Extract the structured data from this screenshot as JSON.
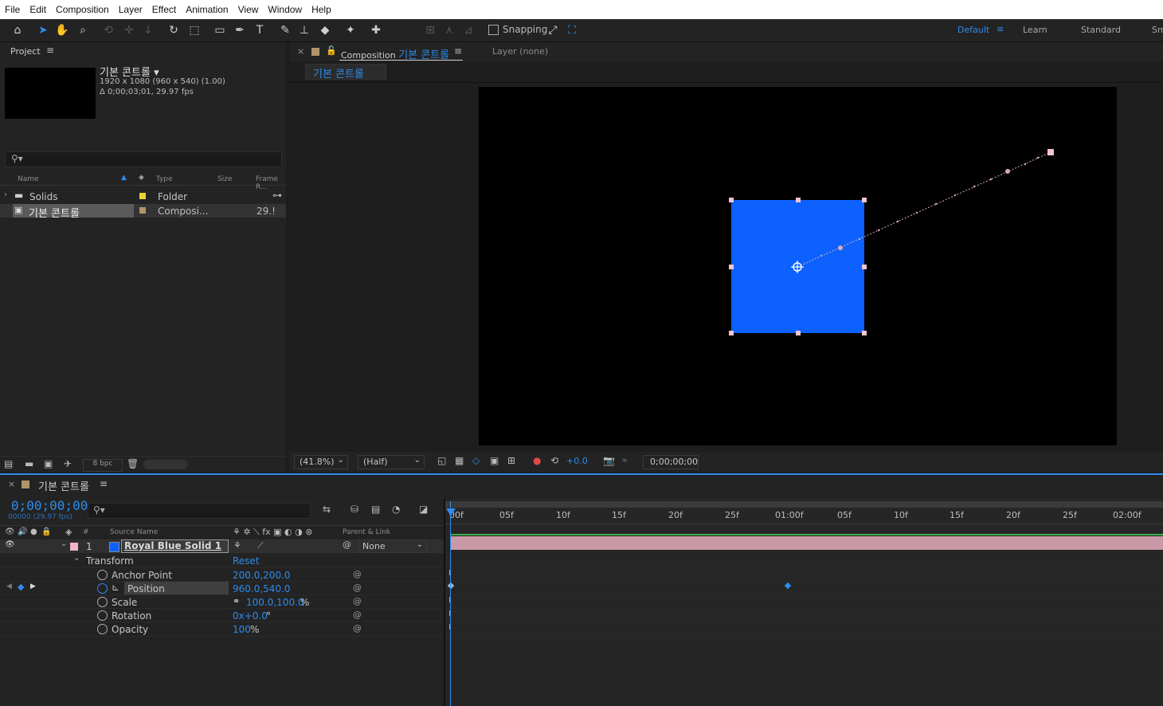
{
  "menu": [
    "File",
    "Edit",
    "Composition",
    "Layer",
    "Effect",
    "Animation",
    "View",
    "Window",
    "Help"
  ],
  "toolbar": {
    "snapping_label": "Snapping",
    "workspaces": [
      "Default",
      "Learn",
      "Standard",
      "Sm"
    ],
    "active_workspace": "Default"
  },
  "project": {
    "tab_label": "Project",
    "comp_name": "기본 콘트롤",
    "comp_info_1": "1920 x 1080  (960 x 540) (1.00)",
    "comp_info_2": "Δ 0;00;03;01, 29.97 fps",
    "search_placeholder": "",
    "columns": [
      "Name",
      "Type",
      "Size",
      "Frame R..."
    ],
    "items": [
      {
        "name": "Solids",
        "type": "Folder",
        "size": "",
        "rate": "",
        "label_color": "#e8d337"
      },
      {
        "name": "기본 콘트롤",
        "type": "Composi...",
        "size": "",
        "rate": "29.!",
        "label_color": "#b0946a"
      }
    ],
    "bpc": "8 bpc"
  },
  "composition": {
    "tab_prefix": "Composition",
    "tab_name": "기본 콘트롤",
    "layer_tab": "Layer  (none)",
    "flow_tab": "기본 콘트롤",
    "zoom": "(41.8%)",
    "resolution": "(Half)",
    "exposure": "+0.0",
    "timecode": "0;00;00;00"
  },
  "timeline": {
    "tab_name": "기본 콘트롤",
    "timecode": "0;00;00;00",
    "frame_info": "00000 (29.97 fps)",
    "headers": {
      "source": "Source Name",
      "parent": "Parent & Link",
      "num": "#"
    },
    "layer": {
      "index": "1",
      "name": "Royal Blue Solid 1",
      "parent": "None",
      "color": "#0c61ff",
      "label_color": "#f3b6c6"
    },
    "transform_label": "Transform",
    "reset_label": "Reset",
    "properties": [
      {
        "name": "Anchor Point",
        "value": "200.0,200.0"
      },
      {
        "name": "Position",
        "value": "960.0,540.0"
      },
      {
        "name": "Scale",
        "value": "100.0,100.0",
        "suffix": "%"
      },
      {
        "name": "Rotation",
        "value": "0x+0.0",
        "suffix": "°"
      },
      {
        "name": "Opacity",
        "value": "100",
        "suffix": "%"
      }
    ],
    "ruler": [
      "00f",
      "05f",
      "10f",
      "15f",
      "20f",
      "25f",
      "01:00f",
      "05f",
      "10f",
      "15f",
      "20f",
      "25f",
      "02:00f"
    ]
  },
  "colors": {
    "accent": "#2d8ceb",
    "solid": "#0c61ff",
    "layer_bar": "#c89aa5",
    "handle": "#f3c3cf"
  }
}
